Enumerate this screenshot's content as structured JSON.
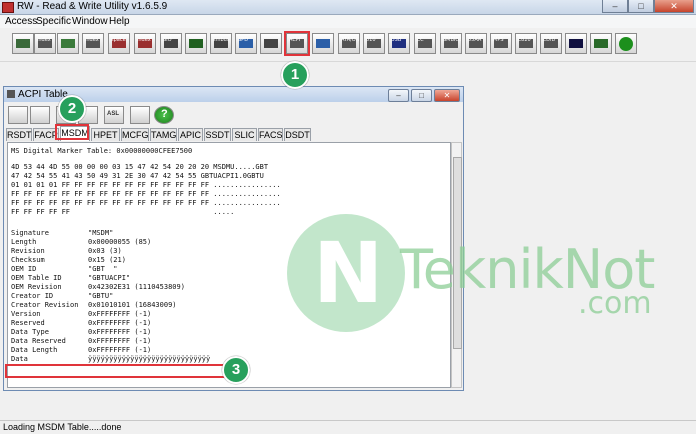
{
  "window": {
    "title": "RW - Read & Write Utility v1.6.5.9"
  },
  "menu": [
    "Access",
    "Specific",
    "Window",
    "Help"
  ],
  "toolbar_icons": [
    {
      "name": "pci-icon",
      "label": ""
    },
    {
      "name": "memory-index-icon",
      "label": "index"
    },
    {
      "name": "memory-icon",
      "label": ""
    },
    {
      "name": "index-icon",
      "label": "index"
    },
    {
      "name": "io-space-icon",
      "label": "space"
    },
    {
      "name": "io-index-icon",
      "label": "index"
    },
    {
      "name": "sio-icon",
      "label": "SIO"
    },
    {
      "name": "oscilloscope-icon",
      "label": ""
    },
    {
      "name": "smbus-icon",
      "label": "smbus"
    },
    {
      "name": "spd-icon",
      "label": "SPD"
    },
    {
      "name": "mcfg-icon",
      "label": ""
    },
    {
      "name": "acpi-icon",
      "label": "ACPI"
    },
    {
      "name": "monitor-icon",
      "label": ""
    },
    {
      "name": "hdd-icon",
      "label": "ATA/ON"
    },
    {
      "name": "disk-icon",
      "label": "010"
    },
    {
      "name": "usb-icon",
      "label": "USB"
    },
    {
      "name": "ec-icon",
      "label": "EC"
    },
    {
      "name": "smbios-icon",
      "label": "SMBIOS"
    },
    {
      "name": "aa-icon",
      "label": "55AA"
    },
    {
      "name": "mps-icon",
      "label": "MPS"
    },
    {
      "name": "e820-icon",
      "label": "E820"
    },
    {
      "name": "edid-icon",
      "label": "EDID"
    },
    {
      "name": "command-icon",
      "label": ""
    },
    {
      "name": "battery-icon",
      "label": ""
    },
    {
      "name": "help-icon",
      "label": "?"
    }
  ],
  "acpi": {
    "title": "ACPI Table",
    "tool_labels": [
      "",
      "",
      "",
      "",
      "ASL",
      "",
      "?"
    ],
    "tabs": [
      "RSDT",
      "FACP",
      "MSDM",
      "HPET",
      "MCFG",
      "TAMG",
      "APIC",
      "SSDT",
      "SLIC",
      "FACS",
      "DSDT"
    ],
    "header": "MS Digital Marker Table: 0x00000000CFEE7500",
    "hex": [
      "4D 53 44 4D 55 00 00 00 03 15 47 42 54 20 20 20 MSDMU.....GBT",
      "47 42 54 55 41 43 50 49 31 2E 30 47 42 54 55 GBTUACPI1.0GBTU",
      "01 01 01 01 FF FF FF FF FF FF FF FF FF FF FF FF ................",
      "FF FF FF FF FF FF FF FF FF FF FF FF FF FF FF FF ................",
      "FF FF FF FF FF FF FF FF FF FF FF FF FF FF FF FF ................",
      "FF FF FF FF FF                                  ....."
    ],
    "fields": [
      [
        "Signature",
        "\"MSDM\""
      ],
      [
        "Length",
        "0x00000055 (85)"
      ],
      [
        "Revision",
        "0x03 (3)"
      ],
      [
        "Checksum",
        "0x15 (21)"
      ],
      [
        "OEM ID",
        "\"GBT  \""
      ],
      [
        "OEM Table ID",
        "\"GBTUACPI\""
      ],
      [
        "OEM Revision",
        "0x42302E31 (1110453809)"
      ],
      [
        "Creator ID",
        "\"GBTU\""
      ],
      [
        "Creator Revision",
        "0x01010101 (16843009)"
      ],
      [
        "Version",
        "0xFFFFFFFF (-1)"
      ],
      [
        "Reserved",
        "0xFFFFFFFF (-1)"
      ],
      [
        "Data Type",
        "0xFFFFFFFF (-1)"
      ],
      [
        "Data Reserved",
        "0xFFFFFFFF (-1)"
      ],
      [
        "Data Length",
        "0xFFFFFFFF (-1)"
      ],
      [
        "Data",
        "ÿÿÿÿÿÿÿÿÿÿÿÿÿÿÿÿÿÿÿÿÿÿÿÿÿÿÿÿÿ"
      ]
    ]
  },
  "status": "Loading MSDM Table.....done",
  "callouts": [
    "1",
    "2",
    "3"
  ],
  "watermark": {
    "text": "TeknikNot",
    "sub": ".com",
    "mark": "N"
  },
  "colors": {
    "callout": "#27a05c",
    "highlight": "#e0343a"
  }
}
